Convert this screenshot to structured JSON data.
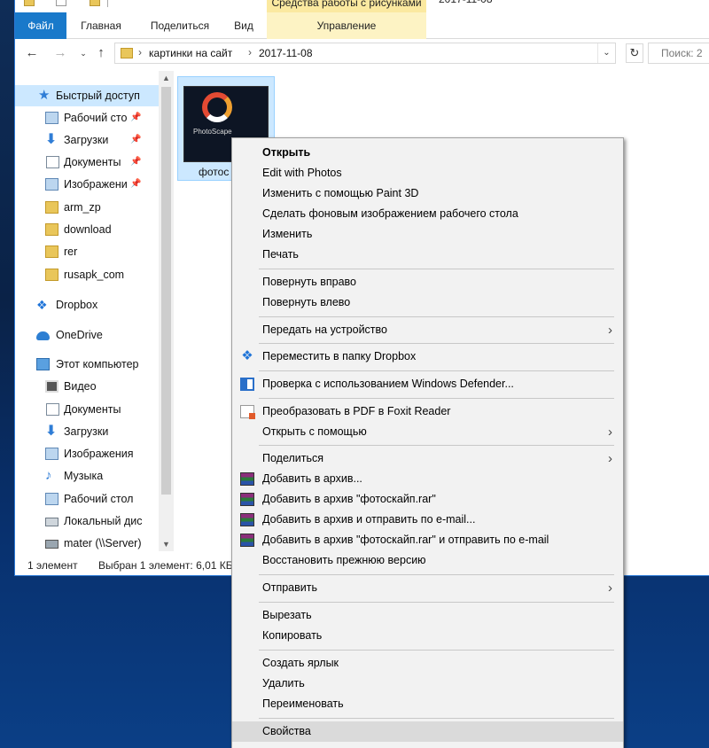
{
  "ribbon": {
    "file_tab": "Файл",
    "home_tab": "Главная",
    "share_tab": "Поделиться",
    "view_tab": "Вид",
    "tools_header": "Средства работы с рисунками",
    "tools_tab": "Управление",
    "window_title_fragment": "2017-11-08"
  },
  "address": {
    "crumbs": [
      "картинки на сайт",
      "2017-11-08"
    ],
    "search_placeholder": "Поиск: 2"
  },
  "nav": {
    "items": [
      {
        "label": "Быстрый доступ",
        "icon": "star-icon"
      },
      {
        "label": "Рабочий сто",
        "icon": "desktop-icon"
      },
      {
        "label": "Загрузки",
        "icon": "download-icon"
      },
      {
        "label": "Документы",
        "icon": "documents-icon"
      },
      {
        "label": "Изображени",
        "icon": "pictures-icon"
      },
      {
        "label": "arm_zp",
        "icon": "folder-icon"
      },
      {
        "label": "download",
        "icon": "folder-icon"
      },
      {
        "label": "rer",
        "icon": "folder-icon"
      },
      {
        "label": "rusapk_com",
        "icon": "folder-icon"
      },
      {
        "label": "Dropbox",
        "icon": "dropbox-icon"
      },
      {
        "label": "OneDrive",
        "icon": "onedrive-icon"
      },
      {
        "label": "Этот компьютер",
        "icon": "computer-icon"
      },
      {
        "label": "Видео",
        "icon": "video-icon"
      },
      {
        "label": "Документы",
        "icon": "documents-icon"
      },
      {
        "label": "Загрузки",
        "icon": "download-icon"
      },
      {
        "label": "Изображения",
        "icon": "pictures-icon"
      },
      {
        "label": "Музыка",
        "icon": "music-icon"
      },
      {
        "label": "Рабочий стол",
        "icon": "desktop-icon"
      },
      {
        "label": "Локальный дис",
        "icon": "disk-icon"
      },
      {
        "label": "mater (\\\\Server)",
        "icon": "network-drive-icon"
      }
    ]
  },
  "file": {
    "name": "фотос",
    "thumb_text": "PhotoScape"
  },
  "status": {
    "count": "1 элемент",
    "selected": "Выбран 1 элемент: 6,01 КБ"
  },
  "menu": {
    "items": [
      {
        "label": "Открыть"
      },
      {
        "label": "Edit with Photos"
      },
      {
        "label": "Изменить с помощью Paint 3D"
      },
      {
        "label": "Сделать фоновым изображением рабочего стола"
      },
      {
        "label": "Изменить"
      },
      {
        "label": "Печать"
      },
      {
        "label": "Повернуть вправо"
      },
      {
        "label": "Повернуть влево"
      },
      {
        "label": "Передать на устройство"
      },
      {
        "label": "Переместить в папку Dropbox"
      },
      {
        "label": "Проверка с использованием Windows Defender..."
      },
      {
        "label": "Преобразовать в PDF в Foxit Reader"
      },
      {
        "label": "Открыть с помощью"
      },
      {
        "label": "Поделиться"
      },
      {
        "label": "Добавить в архив..."
      },
      {
        "label": "Добавить в архив \"фотоскайп.rar\""
      },
      {
        "label": "Добавить в архив и отправить по e-mail..."
      },
      {
        "label": "Добавить в архив \"фотоскайп.rar\" и отправить по e-mail"
      },
      {
        "label": "Восстановить прежнюю версию"
      },
      {
        "label": "Отправить"
      },
      {
        "label": "Вырезать"
      },
      {
        "label": "Копировать"
      },
      {
        "label": "Создать ярлык"
      },
      {
        "label": "Удалить"
      },
      {
        "label": "Переименовать"
      },
      {
        "label": "Свойства"
      }
    ]
  }
}
